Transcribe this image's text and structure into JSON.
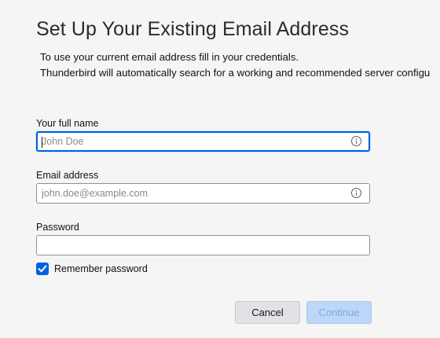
{
  "header": {
    "title": "Set Up Your Existing Email Address",
    "description_line1": "To use your current email address fill in your credentials.",
    "description_line2": "Thunderbird will automatically search for a working and recommended server configu"
  },
  "form": {
    "full_name": {
      "label": "Your full name",
      "placeholder": "John Doe",
      "value": "",
      "focused": true,
      "icon": "info-icon"
    },
    "email": {
      "label": "Email address",
      "placeholder": "john.doe@example.com",
      "value": "",
      "icon": "info-icon"
    },
    "password": {
      "label": "Password",
      "value": ""
    },
    "remember_password": {
      "label": "Remember password",
      "checked": true
    }
  },
  "actions": {
    "cancel_label": "Cancel",
    "continue_label": "Continue",
    "continue_enabled": false
  },
  "colors": {
    "accent": "#0061e0",
    "background": "#f5f5f5",
    "disabled_button": "#bcd7f7"
  }
}
